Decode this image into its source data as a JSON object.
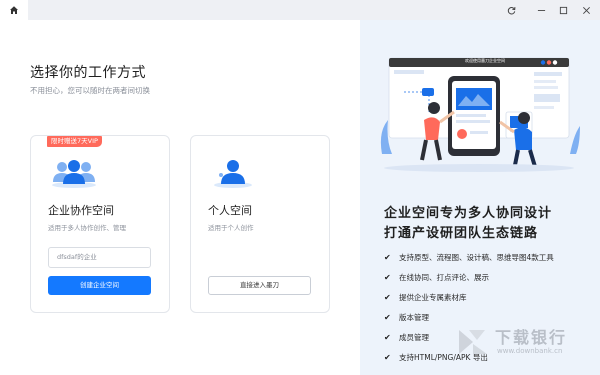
{
  "titlebar": {
    "home_icon": "home-icon",
    "refresh_icon": "refresh-icon",
    "minimize_icon": "minimize-icon",
    "maximize_icon": "maximize-icon",
    "close_icon": "close-icon"
  },
  "left": {
    "heading": "选择你的工作方式",
    "subheading": "不用担心，您可以随时在两者间切换",
    "team_card": {
      "badge": "限时赠送7天VIP",
      "title": "企业协作空间",
      "desc": "适用于多人协作创作、管理",
      "input_value": "dfsdaf的企业",
      "button": "创建企业空间"
    },
    "personal_card": {
      "title": "个人空间",
      "desc": "适用于个人创作",
      "button": "直接进入墨刀"
    }
  },
  "right": {
    "illustration_banner": "欢迎使用墨刀企业空间",
    "headline_line1": "企业空间专为多人协同设计",
    "headline_line2": "打通产设研团队生态链路",
    "features": [
      "支持原型、流程图、设计稿、思维导图4款工具",
      "在线协同、打点评论、展示",
      "提供企业专属素材库",
      "版本管理",
      "成员管理",
      "支持HTML/PNG/APK 导出"
    ],
    "watermark_title": "下载银行",
    "watermark_url": "www.downbank.cn"
  },
  "colors": {
    "primary": "#1479ff",
    "badge": "#ff6a5b",
    "right_bg": "#edf3fb"
  }
}
